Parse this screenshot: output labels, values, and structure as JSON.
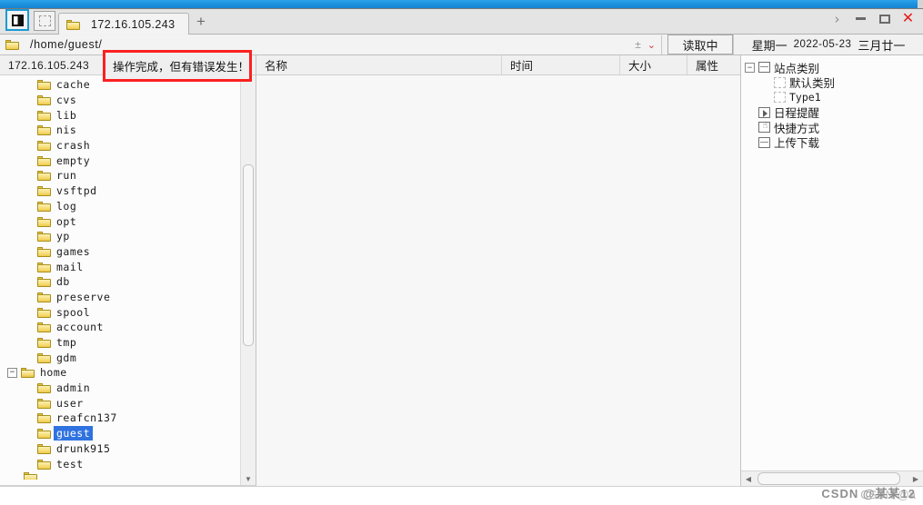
{
  "window": {
    "controls": {
      "expand_label": "›",
      "minimize_label": "",
      "maximize_label": "",
      "close_label": "✕"
    }
  },
  "tabbar": {
    "system_button_icon": "split-pane-icon",
    "secondary_button_icon": "dotted-square-icon",
    "tabs": [
      {
        "label": "172.16.105.243",
        "icon": "folder-icon",
        "active": true
      }
    ],
    "add_tab_label": "+"
  },
  "address": {
    "icon": "folder-icon",
    "path": "/home/guest/",
    "plus_minus_label": "±",
    "chevron_label": "⌄",
    "read_button_label": "读取中"
  },
  "date_header": {
    "weekday": "星期一",
    "date": "2022-05-23",
    "lunar": "三月廿一"
  },
  "error_callout": {
    "message": "操作完成，但有错误发生！",
    "border_color": "#fb2020"
  },
  "left_pane": {
    "header": "172.16.105.243",
    "tree": [
      {
        "label": "cache",
        "indent": 2,
        "expander": "none",
        "selected": false
      },
      {
        "label": "cvs",
        "indent": 2,
        "expander": "none",
        "selected": false
      },
      {
        "label": "lib",
        "indent": 2,
        "expander": "none",
        "selected": false
      },
      {
        "label": "nis",
        "indent": 2,
        "expander": "none",
        "selected": false
      },
      {
        "label": "crash",
        "indent": 2,
        "expander": "none",
        "selected": false
      },
      {
        "label": "empty",
        "indent": 2,
        "expander": "none",
        "selected": false
      },
      {
        "label": "run",
        "indent": 2,
        "expander": "none",
        "selected": false
      },
      {
        "label": "vsftpd",
        "indent": 2,
        "expander": "none",
        "selected": false
      },
      {
        "label": "log",
        "indent": 2,
        "expander": "none",
        "selected": false
      },
      {
        "label": "opt",
        "indent": 2,
        "expander": "none",
        "selected": false
      },
      {
        "label": "yp",
        "indent": 2,
        "expander": "none",
        "selected": false
      },
      {
        "label": "games",
        "indent": 2,
        "expander": "none",
        "selected": false
      },
      {
        "label": "mail",
        "indent": 2,
        "expander": "none",
        "selected": false
      },
      {
        "label": "db",
        "indent": 2,
        "expander": "none",
        "selected": false
      },
      {
        "label": "preserve",
        "indent": 2,
        "expander": "none",
        "selected": false
      },
      {
        "label": "spool",
        "indent": 2,
        "expander": "none",
        "selected": false
      },
      {
        "label": "account",
        "indent": 2,
        "expander": "none",
        "selected": false
      },
      {
        "label": "tmp",
        "indent": 2,
        "expander": "none",
        "selected": false
      },
      {
        "label": "gdm",
        "indent": 2,
        "expander": "none",
        "selected": false
      },
      {
        "label": "home",
        "indent": 1,
        "expander": "minus",
        "selected": false
      },
      {
        "label": "admin",
        "indent": 2,
        "expander": "none",
        "selected": false
      },
      {
        "label": "user",
        "indent": 2,
        "expander": "none",
        "selected": false
      },
      {
        "label": "reafcn137",
        "indent": 2,
        "expander": "none",
        "selected": false
      },
      {
        "label": "guest",
        "indent": 2,
        "expander": "none",
        "selected": true
      },
      {
        "label": "drunk915",
        "indent": 2,
        "expander": "none",
        "selected": false
      },
      {
        "label": "test",
        "indent": 2,
        "expander": "none",
        "selected": false
      }
    ],
    "scroll_down_arrow": "▼"
  },
  "file_list": {
    "columns": [
      {
        "label": "名称"
      },
      {
        "label": "时间"
      },
      {
        "label": "大小"
      },
      {
        "label": "属性"
      }
    ],
    "rows": []
  },
  "right_pane": {
    "tree": [
      {
        "label": "站点类别",
        "icon": "window-icon",
        "expander": "minus",
        "indent": 0,
        "mono": false
      },
      {
        "label": "默认类别",
        "icon": "dotted-square-icon",
        "expander": "none",
        "indent": 1,
        "mono": false
      },
      {
        "label": "Type1",
        "icon": "dotted-square-icon",
        "expander": "none",
        "indent": 1,
        "mono": true
      },
      {
        "label": "日程提醒",
        "icon": "play-icon",
        "expander": "none",
        "indent": 0,
        "mono": false
      },
      {
        "label": "快捷方式",
        "icon": "hand-icon",
        "expander": "none",
        "indent": 0,
        "mono": false
      },
      {
        "label": "上传下载",
        "icon": "window-icon",
        "expander": "none",
        "indent": 0,
        "mono": false
      }
    ],
    "hscroll": {
      "left_arrow": "◀",
      "right_arrow": "▶"
    }
  },
  "watermark": {
    "prefix": "CSDN @a",
    "overlay": "CSDN @某某12"
  }
}
